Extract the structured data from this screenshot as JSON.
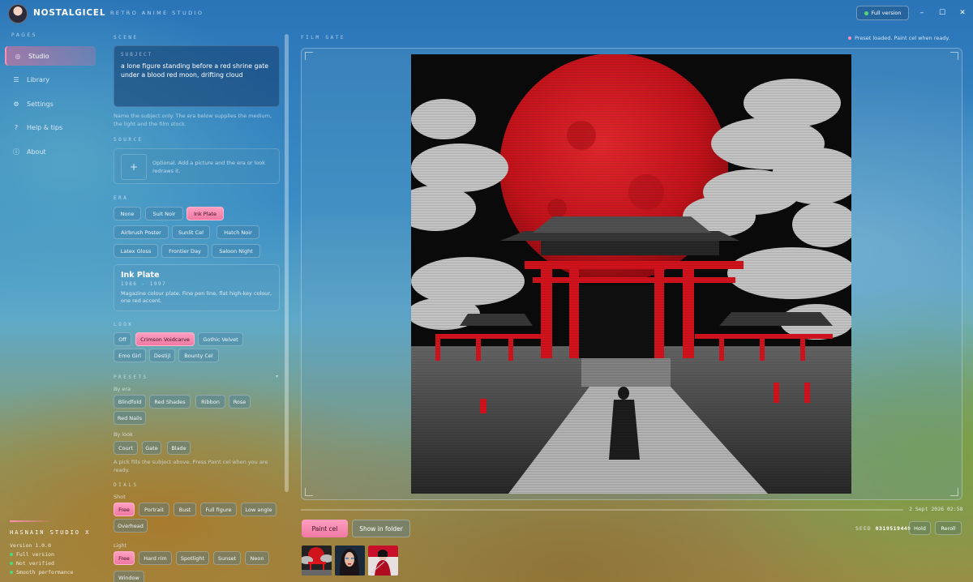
{
  "app": {
    "brand": "NOSTALGICEL",
    "tagline": "RETRO ANIME STUDIO",
    "full_version_label": "Full version",
    "window_controls": [
      "minimize-icon",
      "maximize-icon",
      "close-icon"
    ]
  },
  "sidebar": {
    "section_label": "PAGES",
    "items": [
      {
        "label": "Studio",
        "icon": "palette-icon",
        "active": true
      },
      {
        "label": "Library",
        "icon": "list-icon",
        "active": false
      },
      {
        "label": "Settings",
        "icon": "gear-icon",
        "active": false
      },
      {
        "label": "Help & tips",
        "icon": "question-icon",
        "active": false
      },
      {
        "label": "About",
        "icon": "info-icon",
        "active": false
      }
    ],
    "footer": {
      "title": "HASNAIN STUDIO X",
      "version": "Version 1.0.0",
      "status": [
        {
          "label": "Full version",
          "color": "#4cdb7a"
        },
        {
          "label": "Not verified",
          "color": "#4cdb7a"
        },
        {
          "label": "Smooth performance",
          "color": "#4cdb7a"
        }
      ]
    }
  },
  "scene": {
    "section_label": "SCENE",
    "subject_label": "SUBJECT",
    "subject_text": "a lone figure standing before a red shrine gate under a blood red moon, drifting cloud",
    "subject_hint": "Name the subject only. The era below supplies the medium, the light and the film stock.",
    "source_label": "SOURCE",
    "source_hint": "Optional. Add a picture and the era or look redraws it.",
    "era_label": "ERA",
    "era_options": [
      {
        "label": "None",
        "active": false
      },
      {
        "label": "Suit Noir",
        "active": false
      },
      {
        "label": "Ink Plate",
        "active": true
      },
      {
        "label": "Airbrush Poster",
        "active": false
      },
      {
        "label": "Sunlit Cel",
        "active": false
      },
      {
        "label": "Hatch Noir",
        "active": false
      },
      {
        "label": "Latex Gloss",
        "active": false
      },
      {
        "label": "Frontier Day",
        "active": false
      },
      {
        "label": "Saloon Night",
        "active": false
      }
    ],
    "era_card": {
      "title": "Ink Plate",
      "years": "1986 - 1997",
      "description": "Magazine colour plate. Fine pen line, flat high-key colour, one red accent."
    },
    "look_label": "LOOK",
    "look_options": [
      {
        "label": "Off",
        "active": false
      },
      {
        "label": "Crimson Voidcarve",
        "active": true
      },
      {
        "label": "Gothic Velvet",
        "active": false
      },
      {
        "label": "Emo Girl",
        "active": false
      },
      {
        "label": "Destijl",
        "active": false
      },
      {
        "label": "Bounty Cel",
        "active": false
      }
    ],
    "presets_label": "PRESETS",
    "presets_by_era_label": "By era",
    "presets_by_era": [
      "Blindfold",
      "Red Shades",
      "Ribbon",
      "Rose",
      "Red Nails"
    ],
    "presets_by_look_label": "By look",
    "presets_by_look": [
      "Court",
      "Gate",
      "Blade"
    ],
    "presets_hint": "A pick fills the subject above. Press Paint cel when you are ready.",
    "dials_label": "DIALS",
    "shot_label": "Shot",
    "shot_options": [
      {
        "label": "Free",
        "active": true
      },
      {
        "label": "Portrait",
        "active": false
      },
      {
        "label": "Bust",
        "active": false
      },
      {
        "label": "Full figure",
        "active": false
      },
      {
        "label": "Low angle",
        "active": false
      },
      {
        "label": "Overhead",
        "active": false
      }
    ],
    "light_label": "Light",
    "light_options": [
      {
        "label": "Free",
        "active": true
      },
      {
        "label": "Hard rim",
        "active": false
      },
      {
        "label": "Spotlight",
        "active": false
      },
      {
        "label": "Sunset",
        "active": false
      },
      {
        "label": "Neon",
        "active": false
      },
      {
        "label": "Window",
        "active": false
      }
    ]
  },
  "film_gate": {
    "label": "FILM GATE",
    "status": "Preset loaded. Paint cel when ready.",
    "timestamp": "2 Sept 2026   02:58",
    "paint_button": "Paint cel",
    "folder_button": "Show in folder",
    "seed_label": "SEED",
    "seed_value": "0319519449",
    "hold_button": "Hold",
    "reroll_button": "Reroll"
  },
  "colors": {
    "accent": "#f079a4",
    "moon": "#d0141c",
    "gate": "#e0141e"
  }
}
